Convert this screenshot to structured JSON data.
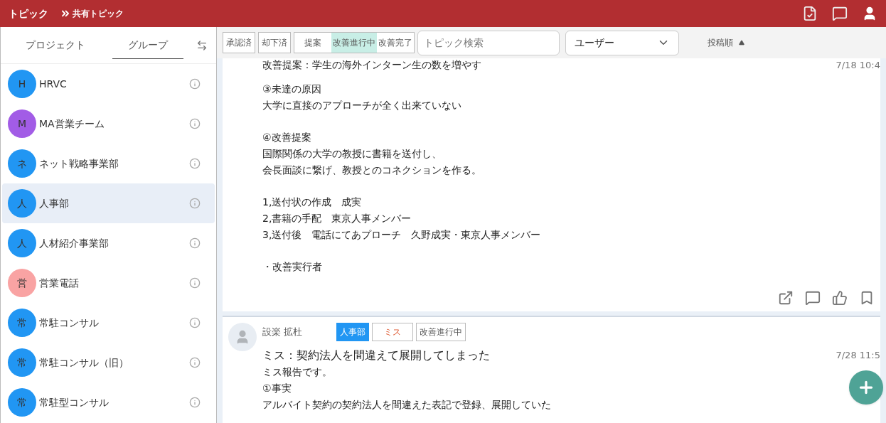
{
  "header": {
    "title": "トピック",
    "breadcrumb": "共有トピック"
  },
  "sidebar": {
    "tabs": [
      {
        "label": "プロジェクト",
        "selected": false
      },
      {
        "label": "グループ",
        "selected": true
      }
    ],
    "groups": [
      {
        "initial": "H",
        "name": "HRVC",
        "color": "#2196f3",
        "selected": false
      },
      {
        "initial": "M",
        "name": "MA営業チーム",
        "color": "#a25ce6",
        "selected": false
      },
      {
        "initial": "ネ",
        "name": "ネット戦略事業部",
        "color": "#2196f3",
        "selected": false
      },
      {
        "initial": "人",
        "name": "人事部",
        "color": "#2196f3",
        "selected": true
      },
      {
        "initial": "人",
        "name": "人材紹介事業部",
        "color": "#2196f3",
        "selected": false
      },
      {
        "initial": "営",
        "name": "営業電話",
        "color": "#f9a3a3",
        "selected": false
      },
      {
        "initial": "常",
        "name": "常駐コンサル",
        "color": "#2196f3",
        "selected": false
      },
      {
        "initial": "常",
        "name": "常駐コンサル（旧）",
        "color": "#2196f3",
        "selected": false
      },
      {
        "initial": "常",
        "name": "常駐型コンサル",
        "color": "#2196f3",
        "selected": false
      }
    ]
  },
  "toolbar": {
    "filters": [
      {
        "label": "承認済",
        "selected": false
      },
      {
        "label": "却下済",
        "selected": false
      }
    ],
    "status_filters": [
      {
        "label": "提案",
        "selected": false
      },
      {
        "label": "改善進行中",
        "selected": true
      },
      {
        "label": "改善完了",
        "selected": false
      }
    ],
    "search": {
      "placeholder": "トピック検索"
    },
    "user_select": {
      "value": "ユーザー"
    },
    "sort": {
      "label": "投稿順"
    }
  },
  "posts": [
    {
      "title": "改善提案：学生の海外インターン生の数を増やす",
      "date": "7/18 10:4",
      "paragraphs": [
        [
          "③未達の原因",
          "大学に直接のアプローチが全く出来ていない"
        ],
        [
          "④改善提案",
          "国際関係の大学の教授に書籍を送付し、",
          "会長面談に繋げ、教授とのコネクションを作る。"
        ],
        [
          "1,送付状の作成　成実",
          "2,書籍の手配　東京人事メンバー",
          "3,送付後　電話にてあプローチ　久野成実・東京人事メンバー"
        ],
        [
          "・改善実行者"
        ]
      ]
    },
    {
      "author": "設楽 拡杜",
      "tags": [
        {
          "label": "人事部",
          "kind": "group"
        },
        {
          "label": "ミス",
          "kind": "category"
        },
        {
          "label": "改善進行中",
          "kind": "status"
        }
      ],
      "title": "ミス：契約法人を間違えて展開してしまった",
      "date": "7/28 11:5",
      "body": [
        "ミス報告です。",
        "①事実",
        "アルバイト契約の契約法人を間違えた表記で登録、展開していた"
      ]
    }
  ]
}
